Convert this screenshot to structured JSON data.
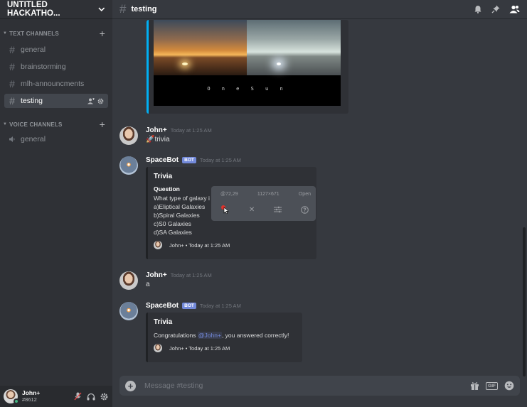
{
  "server": {
    "name": "UNTITLED HACKATHO..."
  },
  "categories": {
    "text": "TEXT CHANNELS",
    "voice": "VOICE CHANNELS"
  },
  "text_channels": [
    {
      "name": "general"
    },
    {
      "name": "brainstorming"
    },
    {
      "name": "mlh-announcments"
    },
    {
      "name": "testing"
    }
  ],
  "voice_channels": [
    {
      "name": "general"
    }
  ],
  "user": {
    "name": "John+",
    "tag": "#8612"
  },
  "topbar": {
    "channel": "testing"
  },
  "image_embed": {
    "caption": "O n e   S u n"
  },
  "messages": [
    {
      "author": "John+",
      "time": "Today at 1:25 AM",
      "text": "trivia",
      "emoji": "🚀"
    },
    {
      "author": "SpaceBot",
      "badge": "BOT",
      "time": "Today at 1:25 AM",
      "embed": {
        "title": "Trivia",
        "field_name": "Question",
        "lines": [
          "What type of galaxy i",
          "a)Eliptical Galaxies",
          "b)Spiral Galaxies",
          "c)S0 Galaxies",
          "d)SA Galaxies"
        ],
        "footer": "John+ • Today at 1:25 AM"
      }
    },
    {
      "author": "John+",
      "time": "Today at 1:25 AM",
      "text": "a"
    },
    {
      "author": "SpaceBot",
      "badge": "BOT",
      "time": "Today at 1:25 AM",
      "embed": {
        "title": "Trivia",
        "text_before": "Congratulations ",
        "mention": "@John+",
        "text_after": ", you answered correctly!",
        "footer": "John+ • Today at 1:25 AM"
      }
    }
  ],
  "overlay": {
    "coords": "@72,29",
    "size": "1127×671",
    "open": "Open"
  },
  "composer": {
    "placeholder": "Message #testing",
    "gif_label": "GIF"
  },
  "icons": {
    "bell": "bell-icon",
    "pin": "pin-icon",
    "members": "members-icon",
    "gift": "gift-icon",
    "emoji": "emoji-icon",
    "mic": "mic-muted-icon",
    "headphones": "headphones-icon",
    "settings": "gear-icon"
  },
  "colors": {
    "accent": "#7289da",
    "image_border": "#00b0f4",
    "online": "#43b581"
  }
}
